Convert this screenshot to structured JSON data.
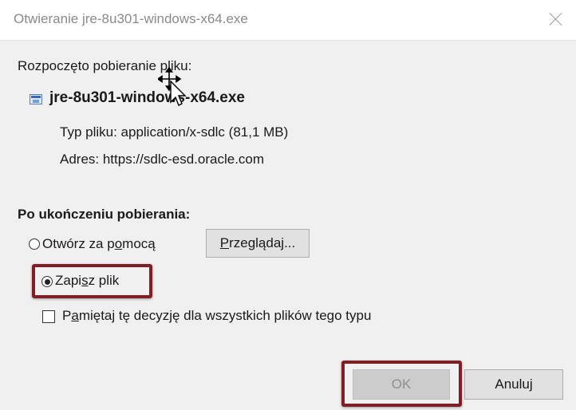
{
  "window": {
    "title": "Otwieranie jre-8u301-windows-x64.exe",
    "close_icon": "close-icon"
  },
  "download": {
    "intro": "Rozpoczęto pobieranie pliku:",
    "file_icon": "executable-file-icon",
    "filename": "jre-8u301-windows-x64.exe",
    "file_type": "Typ pliku: application/x-sdlc (81,1 MB)",
    "address": "Adres: https://sdlc-esd.oracle.com"
  },
  "after_download": {
    "label": "Po ukończeniu pobierania:",
    "open_with": {
      "label_before": "Otwórz za p",
      "label_access": "o",
      "label_after": "mocą",
      "selected": false
    },
    "browse_button": {
      "access": "P",
      "rest": "rzeglądaj..."
    },
    "save_file": {
      "label_before": "Zapi",
      "label_access": "s",
      "label_after": "z plik",
      "selected": true
    },
    "remember": {
      "label_before": "P",
      "label_access": "a",
      "label_after": "miętaj tę decyzję dla wszystkich plików tego typu",
      "checked": false
    }
  },
  "buttons": {
    "ok": "OK",
    "cancel": "Anuluj"
  },
  "annotations": {
    "highlight_color": "#7f1f25"
  },
  "cursor": {
    "icon": "move-cursor-icon"
  }
}
